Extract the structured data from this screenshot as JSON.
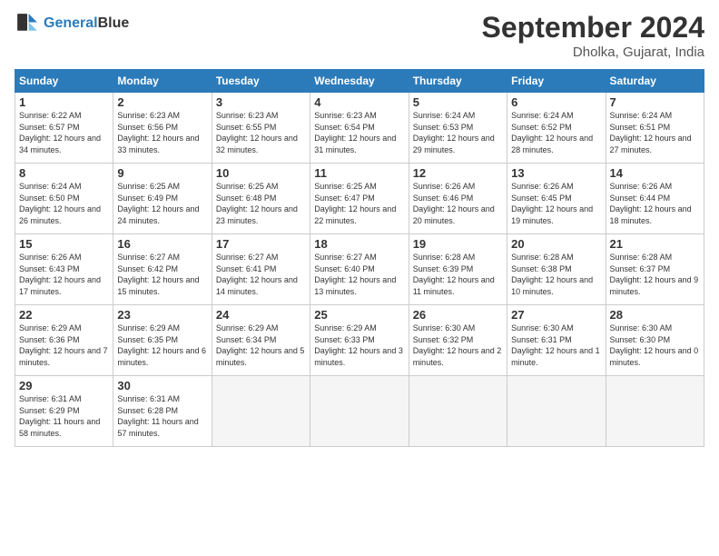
{
  "header": {
    "logo_line1": "General",
    "logo_line2": "Blue",
    "month": "September 2024",
    "location": "Dholka, Gujarat, India"
  },
  "days_of_week": [
    "Sunday",
    "Monday",
    "Tuesday",
    "Wednesday",
    "Thursday",
    "Friday",
    "Saturday"
  ],
  "weeks": [
    [
      {
        "num": "1",
        "rise": "6:22 AM",
        "set": "6:57 PM",
        "daylight": "12 hours and 34 minutes."
      },
      {
        "num": "2",
        "rise": "6:23 AM",
        "set": "6:56 PM",
        "daylight": "12 hours and 33 minutes."
      },
      {
        "num": "3",
        "rise": "6:23 AM",
        "set": "6:55 PM",
        "daylight": "12 hours and 32 minutes."
      },
      {
        "num": "4",
        "rise": "6:23 AM",
        "set": "6:54 PM",
        "daylight": "12 hours and 31 minutes."
      },
      {
        "num": "5",
        "rise": "6:24 AM",
        "set": "6:53 PM",
        "daylight": "12 hours and 29 minutes."
      },
      {
        "num": "6",
        "rise": "6:24 AM",
        "set": "6:52 PM",
        "daylight": "12 hours and 28 minutes."
      },
      {
        "num": "7",
        "rise": "6:24 AM",
        "set": "6:51 PM",
        "daylight": "12 hours and 27 minutes."
      }
    ],
    [
      {
        "num": "8",
        "rise": "6:24 AM",
        "set": "6:50 PM",
        "daylight": "12 hours and 26 minutes."
      },
      {
        "num": "9",
        "rise": "6:25 AM",
        "set": "6:49 PM",
        "daylight": "12 hours and 24 minutes."
      },
      {
        "num": "10",
        "rise": "6:25 AM",
        "set": "6:48 PM",
        "daylight": "12 hours and 23 minutes."
      },
      {
        "num": "11",
        "rise": "6:25 AM",
        "set": "6:47 PM",
        "daylight": "12 hours and 22 minutes."
      },
      {
        "num": "12",
        "rise": "6:26 AM",
        "set": "6:46 PM",
        "daylight": "12 hours and 20 minutes."
      },
      {
        "num": "13",
        "rise": "6:26 AM",
        "set": "6:45 PM",
        "daylight": "12 hours and 19 minutes."
      },
      {
        "num": "14",
        "rise": "6:26 AM",
        "set": "6:44 PM",
        "daylight": "12 hours and 18 minutes."
      }
    ],
    [
      {
        "num": "15",
        "rise": "6:26 AM",
        "set": "6:43 PM",
        "daylight": "12 hours and 17 minutes."
      },
      {
        "num": "16",
        "rise": "6:27 AM",
        "set": "6:42 PM",
        "daylight": "12 hours and 15 minutes."
      },
      {
        "num": "17",
        "rise": "6:27 AM",
        "set": "6:41 PM",
        "daylight": "12 hours and 14 minutes."
      },
      {
        "num": "18",
        "rise": "6:27 AM",
        "set": "6:40 PM",
        "daylight": "12 hours and 13 minutes."
      },
      {
        "num": "19",
        "rise": "6:28 AM",
        "set": "6:39 PM",
        "daylight": "12 hours and 11 minutes."
      },
      {
        "num": "20",
        "rise": "6:28 AM",
        "set": "6:38 PM",
        "daylight": "12 hours and 10 minutes."
      },
      {
        "num": "21",
        "rise": "6:28 AM",
        "set": "6:37 PM",
        "daylight": "12 hours and 9 minutes."
      }
    ],
    [
      {
        "num": "22",
        "rise": "6:29 AM",
        "set": "6:36 PM",
        "daylight": "12 hours and 7 minutes."
      },
      {
        "num": "23",
        "rise": "6:29 AM",
        "set": "6:35 PM",
        "daylight": "12 hours and 6 minutes."
      },
      {
        "num": "24",
        "rise": "6:29 AM",
        "set": "6:34 PM",
        "daylight": "12 hours and 5 minutes."
      },
      {
        "num": "25",
        "rise": "6:29 AM",
        "set": "6:33 PM",
        "daylight": "12 hours and 3 minutes."
      },
      {
        "num": "26",
        "rise": "6:30 AM",
        "set": "6:32 PM",
        "daylight": "12 hours and 2 minutes."
      },
      {
        "num": "27",
        "rise": "6:30 AM",
        "set": "6:31 PM",
        "daylight": "12 hours and 1 minute."
      },
      {
        "num": "28",
        "rise": "6:30 AM",
        "set": "6:30 PM",
        "daylight": "12 hours and 0 minutes."
      }
    ],
    [
      {
        "num": "29",
        "rise": "6:31 AM",
        "set": "6:29 PM",
        "daylight": "11 hours and 58 minutes."
      },
      {
        "num": "30",
        "rise": "6:31 AM",
        "set": "6:28 PM",
        "daylight": "11 hours and 57 minutes."
      },
      null,
      null,
      null,
      null,
      null
    ]
  ]
}
